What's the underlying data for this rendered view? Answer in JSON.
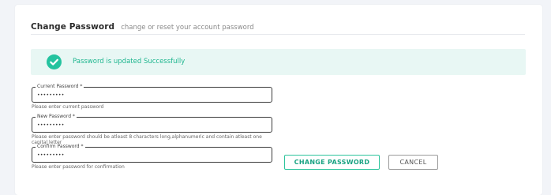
{
  "header": {
    "title": "Change Password",
    "subtitle": "change or reset your account password"
  },
  "alert": {
    "icon": "check-circle-icon",
    "message": "Password is updated Successfully",
    "color": "#24c39f"
  },
  "fields": {
    "current": {
      "label": "Current Password *",
      "value": "•••••••••",
      "helper": "Please enter current password"
    },
    "new": {
      "label": "New Password *",
      "value": "•••••••••",
      "helper": "Please enter password should be atleast 8 characters long,alphanumeric and contain atleast one capital letter"
    },
    "confirm": {
      "label": "Confirm Password *",
      "value": "•••••••••",
      "helper": "Please enter password for confirmation"
    }
  },
  "buttons": {
    "change_label": "CHANGE PASSWORD",
    "cancel_label": "CANCEL"
  }
}
